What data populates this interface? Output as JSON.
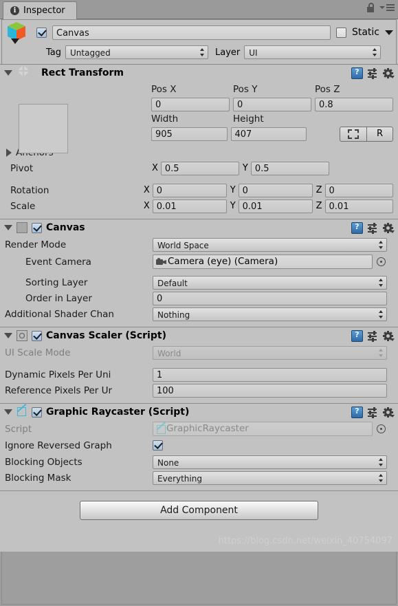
{
  "window": {
    "tab_label": "Inspector",
    "tab_icon": "info-icon",
    "lock_icon": "lock-icon",
    "menu_icon": "hamburger-menu-icon"
  },
  "object_header": {
    "prefab_icon": "prefab-cube-icon",
    "enabled_checkbox": true,
    "name_value": "Canvas",
    "static_checkbox": false,
    "static_label": "Static",
    "static_dropdown_icon": "chevron-down-icon",
    "tag_label": "Tag",
    "tag_value": "Untagged",
    "layer_label": "Layer",
    "layer_value": "UI"
  },
  "components": [
    {
      "id": "rect-transform",
      "icon": "rect-transform-icon",
      "title": "Rect Transform",
      "expanded": true,
      "has_checkbox": false,
      "fields": {
        "pos_x_label": "Pos X",
        "pos_x_value": "0",
        "pos_y_label": "Pos Y",
        "pos_y_value": "0",
        "pos_z_label": "Pos Z",
        "pos_z_value": "0.8",
        "width_label": "Width",
        "width_value": "905",
        "height_label": "Height",
        "height_value": "407",
        "blueprint_button": "blueprint-mode-icon",
        "raw_button": "R",
        "anchors_label": "Anchors",
        "pivot_label": "Pivot",
        "pivot_x_axis": "X",
        "pivot_x": "0.5",
        "pivot_y_axis": "Y",
        "pivot_y": "0.5",
        "rotation_label": "Rotation",
        "rotation_x_axis": "X",
        "rotation_x": "0",
        "rotation_y_axis": "Y",
        "rotation_y": "0",
        "rotation_z_axis": "Z",
        "rotation_z": "0",
        "scale_label": "Scale",
        "scale_x_axis": "X",
        "scale_x": "0.01",
        "scale_y_axis": "Y",
        "scale_y": "0.01",
        "scale_z_axis": "Z",
        "scale_z": "0.01"
      }
    },
    {
      "id": "canvas",
      "icon": "canvas-icon",
      "title": "Canvas",
      "expanded": true,
      "has_checkbox": true,
      "checked": true,
      "fields": {
        "render_mode_label": "Render Mode",
        "render_mode_value": "World Space",
        "event_camera_label": "Event Camera",
        "event_camera_value": "Camera (eye) (Camera)",
        "event_camera_icon": "camera-icon",
        "sorting_layer_label": "Sorting Layer",
        "sorting_layer_value": "Default",
        "order_in_layer_label": "Order in Layer",
        "order_in_layer_value": "0",
        "shader_channels_label": "Additional Shader Chan",
        "shader_channels_value": "Nothing"
      }
    },
    {
      "id": "canvas-scaler",
      "icon": "canvas-scaler-icon",
      "title": "Canvas Scaler (Script)",
      "expanded": true,
      "has_checkbox": true,
      "checked": true,
      "fields": {
        "ui_scale_mode_label": "UI Scale Mode",
        "ui_scale_mode_value": "World",
        "dynamic_ppu_label": "Dynamic Pixels Per Uni",
        "dynamic_ppu_value": "1",
        "reference_ppu_label": "Reference Pixels Per Ur",
        "reference_ppu_value": "100"
      }
    },
    {
      "id": "graphic-raycaster",
      "icon": "graphic-raycaster-icon",
      "title": "Graphic Raycaster (Script)",
      "expanded": true,
      "has_checkbox": true,
      "checked": true,
      "fields": {
        "script_label": "Script",
        "script_value": "GraphicRaycaster",
        "ignore_reversed_label": "Ignore Reversed Graph",
        "ignore_reversed_checked": true,
        "blocking_objects_label": "Blocking Objects",
        "blocking_objects_value": "None",
        "blocking_mask_label": "Blocking Mask",
        "blocking_mask_value": "Everything"
      }
    }
  ],
  "footer": {
    "add_component_label": "Add Component",
    "watermark": "https://blog.csdn.net/weixin_40754097"
  },
  "header_icons": {
    "help": "help-book-icon",
    "preset": "preset-icon",
    "gear": "gear-icon"
  },
  "colors": {
    "panel_bg": "#c2c2c2",
    "window_bg": "#9e9e9e",
    "accent_blue": "#3c6eb4",
    "raycaster_cyan": "#3fb7d4"
  }
}
